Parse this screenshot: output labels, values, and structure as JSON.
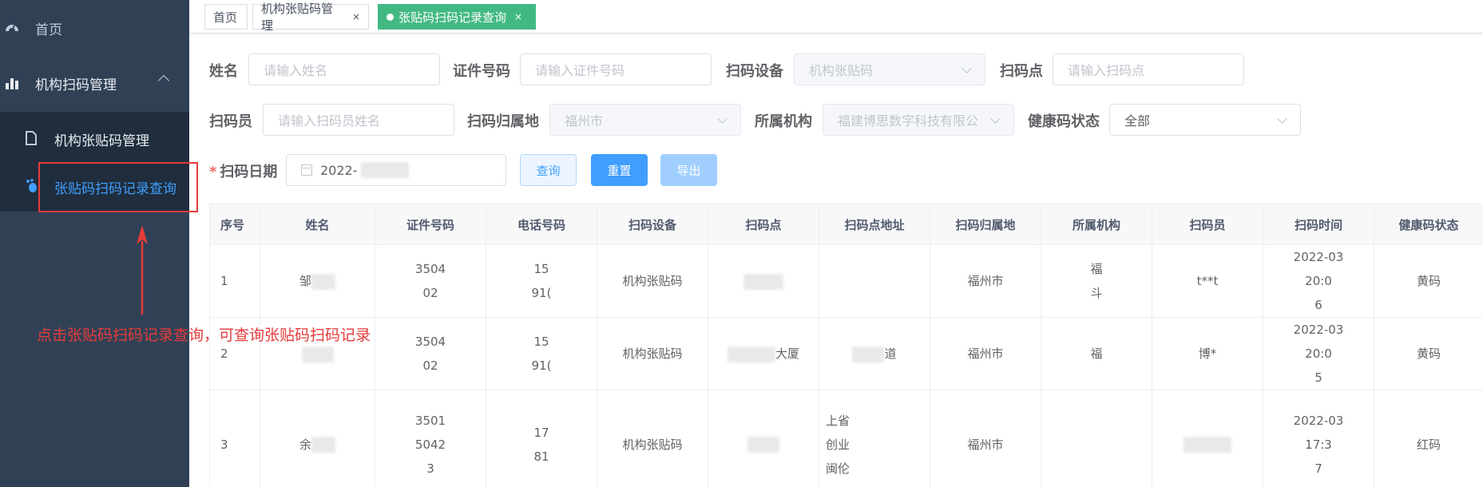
{
  "sidebar": {
    "home": "首页",
    "group": "机构扫码管理",
    "items": [
      {
        "label": "机构张贴码管理"
      },
      {
        "label": "张贴码扫码记录查询"
      }
    ]
  },
  "tabs": [
    {
      "label": "首页"
    },
    {
      "label": "机构张贴码管理",
      "close": "×"
    },
    {
      "label": "张贴码扫码记录查询",
      "close": "×"
    }
  ],
  "form": {
    "name": {
      "label": "姓名",
      "placeholder": "请输入姓名"
    },
    "id": {
      "label": "证件号码",
      "placeholder": "请输入证件号码"
    },
    "device": {
      "label": "扫码设备",
      "value": "机构张贴码"
    },
    "point": {
      "label": "扫码点",
      "placeholder": "请输入扫码点"
    },
    "scanner": {
      "label": "扫码员",
      "placeholder": "请输入扫码员姓名"
    },
    "region": {
      "label": "扫码归属地",
      "value": "福州市"
    },
    "org": {
      "label": "所属机构",
      "value": "福建博思数字科技有限公"
    },
    "health": {
      "label": "健康码状态",
      "value": "全部"
    },
    "date": {
      "label": "扫码日期",
      "required": "*",
      "value": "2022-"
    }
  },
  "buttons": {
    "query": "查询",
    "reset": "重置",
    "export": "导出"
  },
  "table": {
    "headers": [
      "序号",
      "姓名",
      "证件号码",
      "电话号码",
      "扫码设备",
      "扫码点",
      "扫码点地址",
      "扫码归属地",
      "所属机构",
      "扫码员",
      "扫码时间",
      "健康码状态"
    ],
    "rows": [
      {
        "seq": "1",
        "name": "邹",
        "id": "3504|02",
        "phone": "15|91(",
        "device": "机构张贴码",
        "point": "",
        "address": "",
        "region": "福州市",
        "org": "福|斗",
        "scanner": "t**t",
        "time": "2022-03|20:0|6",
        "status": "黄码"
      },
      {
        "seq": "2",
        "name": "",
        "id": "3504|02",
        "phone": "15|91(",
        "device": "机构张贴码",
        "point": "大厦",
        "address": "道",
        "region": "福州市",
        "org": "福",
        "scanner": "博*",
        "time": "2022-03|20:0|5",
        "status": "黄码"
      },
      {
        "seq": "3",
        "name": "余",
        "id": "3501|5042|3",
        "phone": "17|81",
        "device": "机构张贴码",
        "point": "",
        "address": "上省|创业|闽伦",
        "region": "福州市",
        "org": "",
        "scanner": "",
        "time": "2022-03|17:3|7",
        "status": "红码"
      }
    ]
  },
  "annotation": "点击张贴码扫码记录查询，可查询张贴码扫码记录",
  "colors": {
    "sidebar": "#304156",
    "active_tab": "#42b983",
    "primary": "#409eff",
    "annotation": "#e63b3b"
  }
}
